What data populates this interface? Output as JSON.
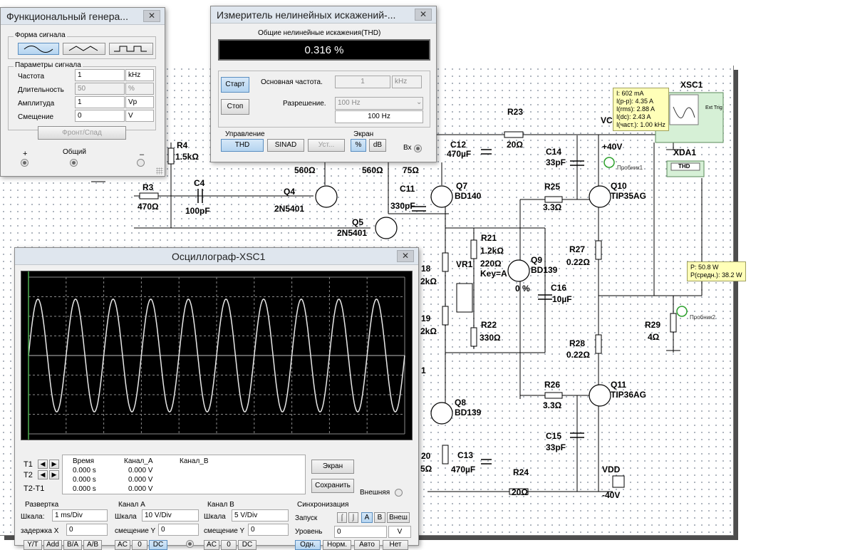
{
  "schematic": {
    "labels": {
      "xsc1": "XSC1",
      "xda1": "XDA1",
      "thd_meter": "THD",
      "vcc": "VCC",
      "vdd": "VDD",
      "plus40v": "+40V",
      "minus40v": "-40V",
      "ext_trig": "Ext Trig",
      "probe1": "Пробник1",
      "probe2": "Пробник2",
      "r23": "R23",
      "r23v": "20Ω",
      "r24": "R24",
      "r24v": "20Ω",
      "r4": "R4",
      "r4v": "1.5kΩ",
      "r3": "R3",
      "r3v": "470Ω",
      "c4": "C4",
      "c4v": "100pF",
      "q4": "Q4",
      "q4t": "2N5401",
      "q5": "Q5",
      "q5t": "2N5401",
      "r560a": "560Ω",
      "r560b": "560Ω",
      "r75": "75Ω",
      "c11": "C11",
      "c11v": "330pF",
      "c12": "C12",
      "c12v": "470µF",
      "q7": "Q7",
      "q7t": "BD140",
      "c14": "C14",
      "c14v": "33pF",
      "r25": "R25",
      "r25v": "3.3Ω",
      "q10": "Q10",
      "q10t": "TIP35AG",
      "r21": "R21",
      "r21v": "1.2kΩ",
      "vr1": "VR1",
      "vr1v": "220Ω",
      "key": "Key=A",
      "pct": "0 %",
      "q9": "Q9",
      "q9t": "BD139",
      "c16": "C16",
      "c16v": "10µF",
      "r27": "R27",
      "r27v": "0.22Ω",
      "r22": "R22",
      "r22v": "330Ω",
      "r28": "R28",
      "r28v": "0.22Ω",
      "r29": "R29",
      "r29v": "4Ω",
      "r26": "R26",
      "r26v": "3.3Ω",
      "q11": "Q11",
      "q11t": "TIP36AG",
      "q8": "Q8",
      "q8t": "BD139",
      "c15": "C15",
      "c15v": "33pF",
      "c13": "C13",
      "c13v": "470µF",
      "cut18": "18",
      "cut2k1": "2kΩ",
      "cut19": "19",
      "cut2k2": "2kΩ",
      "cut1": "1",
      "cut20": "20",
      "cut5": "5Ω"
    },
    "probe1_tooltip": [
      "I: 602 mA",
      "I(p-p): 4.35 A",
      "I(rms): 2.88 A",
      "I(dc): 2.43 A",
      "I(част.): 1.00 kHz"
    ],
    "probe2_tooltip": [
      "P: 50.8 W",
      "P(средн.): 38.2 W"
    ]
  },
  "fgen": {
    "title": "Функциональный генера...",
    "waveform_group": "Форма сигнала",
    "params_group": "Параметры сигнала",
    "rows": [
      {
        "label": "Частота",
        "value": "1",
        "unit": "kHz",
        "disabled": false
      },
      {
        "label": "Длительность",
        "value": "50",
        "unit": "%",
        "disabled": true
      },
      {
        "label": "Амплитуда",
        "value": "1",
        "unit": "Vp",
        "disabled": false
      },
      {
        "label": "Смещение",
        "value": "0",
        "unit": "V",
        "disabled": false
      }
    ],
    "rise_fall": "Фронт/Спад",
    "plus": "+",
    "common": "Общий",
    "minus": "–"
  },
  "dist": {
    "title": "Измеритель нелинейных искажений-...",
    "thd_caption": "Общие нелинейные искажения(THD)",
    "thd_value": "0.316 %",
    "start": "Старт",
    "stop": "Стоп",
    "fund_label": "Основная частота.",
    "fund_value": "1",
    "fund_unit": "kHz",
    "res_label": "Разрешение.",
    "res_value": "100 Hz",
    "res_value2": "100 Hz",
    "control": "Управление",
    "thd_btn": "THD",
    "sinad_btn": "SINAD",
    "set_btn": "Уст...",
    "screen": "Экран",
    "pct_btn": "%",
    "db_btn": "dB",
    "in": "Вх"
  },
  "scope": {
    "title": "Осциллограф-XSC1",
    "t1": "T1",
    "t2": "T2",
    "t2t1": "T2-T1",
    "cols": {
      "time": "Время",
      "cha": "Канал_A",
      "chb": "Канал_B"
    },
    "readings": [
      {
        "time": "0.000 s",
        "cha": "0.000 V"
      },
      {
        "time": "0.000 s",
        "cha": "0.000 V"
      },
      {
        "time": "0.000 s",
        "cha": "0.000 V"
      }
    ],
    "screen_btn": "Экран",
    "save_btn": "Сохранить",
    "external": "Внешняя",
    "timebase": {
      "title": "Развертка",
      "scale_label": "Шкала:",
      "scale": "1 ms/Div",
      "delay_label": "задержка X",
      "delay": "0"
    },
    "cha": {
      "title": "Канал A",
      "scale_label": "Шкала",
      "scale": "10  V/Div",
      "offset_label": "смещение Y",
      "offset": "0"
    },
    "chb": {
      "title": "Канал B",
      "scale_label": "Шкала",
      "scale": "5  V/Div",
      "offset_label": "смещение Y",
      "offset": "0"
    },
    "trigger": {
      "title": "Синхронизация",
      "start_label": "Запуск",
      "a": "A",
      "b": "B",
      "ext": "Внеш",
      "level_label": "Уровень",
      "level": "0",
      "level_unit": "V"
    },
    "bottom_btns": [
      "Y/T",
      "Add",
      "B/A",
      "A/B",
      "AC",
      "0",
      "DC",
      "AC",
      "0",
      "DC",
      "Одн.",
      "Норм.",
      "Авто",
      "Нет"
    ],
    "wave": {
      "cycles": 10,
      "color": "#e8e8e8"
    }
  },
  "colors": {
    "accent": "#3a7bd5",
    "tooltip_bg": "#ffffb8",
    "probe_green": "#2ca02c"
  }
}
